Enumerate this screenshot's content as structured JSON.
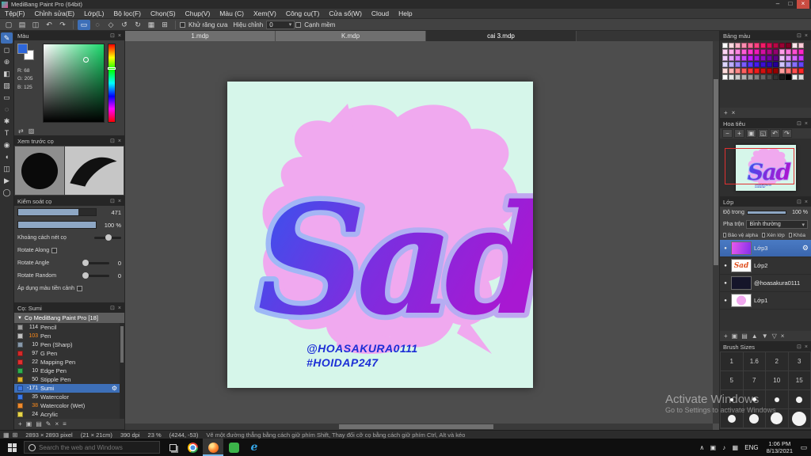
{
  "window": {
    "title": "MediBang Paint Pro (64bit)",
    "controls": {
      "minimize": "–",
      "maximize": "□",
      "close": "×"
    }
  },
  "glyphs": {
    "eye": "●",
    "gear": "⚙",
    "caret_down": "▾",
    "group_caret": "▼"
  },
  "panel_chrome": {
    "pop": "⊡",
    "close": "×"
  },
  "menu": {
    "items": [
      "Tệp(F)",
      "Chỉnh sửa(E)",
      "Lớp(L)",
      "Bộ lọc(F)",
      "Chọn(S)",
      "Chụp(V)",
      "Màu (C)",
      "Xem(V)",
      "Công cụ(T)",
      "Cửa sổ(W)",
      "Cloud",
      "Help"
    ]
  },
  "toolbar": {
    "file_icons": [
      {
        "name": "new-file",
        "glyph": "▢"
      },
      {
        "name": "open-file",
        "glyph": "▤"
      },
      {
        "name": "save-file",
        "glyph": "◫"
      },
      {
        "name": "undo",
        "glyph": "↶"
      },
      {
        "name": "redo",
        "glyph": "↷"
      }
    ],
    "edit_icons": [
      {
        "name": "select-rect",
        "glyph": "▭",
        "active": true
      },
      {
        "name": "lasso-select",
        "glyph": "◌"
      },
      {
        "name": "transform",
        "glyph": "◇"
      },
      {
        "name": "rotate-left",
        "glyph": "↺"
      },
      {
        "name": "rotate-right",
        "glyph": "↻"
      },
      {
        "name": "grid-toggle",
        "glyph": "▦"
      },
      {
        "name": "snap-toggle",
        "glyph": "⊞"
      }
    ],
    "antialias_label": "Khử răng cưa",
    "correction_label": "Hiệu chỉnh",
    "correction_value": "0",
    "soft_edge_label": "Cạnh mềm"
  },
  "tabs": [
    {
      "label": "1.mdp"
    },
    {
      "label": "K.mdp"
    },
    {
      "label": "cai 3.mdp",
      "active": true
    }
  ],
  "tool_strip": [
    {
      "name": "brush-tool",
      "glyph": "✎",
      "active": true
    },
    {
      "name": "eraser-tool",
      "glyph": "◻"
    },
    {
      "name": "move-tool",
      "glyph": "⊕"
    },
    {
      "name": "fill-tool",
      "glyph": "◧"
    },
    {
      "name": "gradient-tool",
      "glyph": "▨"
    },
    {
      "name": "select-tool",
      "glyph": "▭"
    },
    {
      "name": "lasso-tool",
      "glyph": "◌"
    },
    {
      "name": "magic-wand-tool",
      "glyph": "✱"
    },
    {
      "name": "text-tool",
      "glyph": "T"
    },
    {
      "name": "eyedropper-tool",
      "glyph": "◉"
    },
    {
      "name": "hand-tool",
      "glyph": "◖"
    },
    {
      "name": "divide-tool",
      "glyph": "◫"
    },
    {
      "name": "operation-tool",
      "glyph": "▶"
    },
    {
      "name": "zoom-tool",
      "glyph": "◯"
    }
  ],
  "color_panel": {
    "title": "Màu",
    "fg_color": "#2d66d9",
    "bg_color": "#ffffff",
    "r_label": "R: 68",
    "g_label": "G: 205",
    "b_label": "B: 125",
    "footer_icons": [
      {
        "name": "swap-colors",
        "glyph": "⇄"
      },
      {
        "name": "transparent-color",
        "glyph": "▨"
      }
    ]
  },
  "brush_preview": {
    "title": "Xem trước cọ"
  },
  "brush_control": {
    "title": "Kiểm soát cọ",
    "size_value": "471",
    "opacity_value": "100 %",
    "spacing_label": "Khoảng cách nét cọ",
    "rotate_along_label": "Rotate Along",
    "rotate_angle_label": "Rotate Angle",
    "rotate_angle_value": "0",
    "rotate_random_label": "Rotate Random",
    "rotate_random_value": "0",
    "fg_apply_label": "Áp dụng màu tiền cảnh"
  },
  "brush_panel": {
    "title": "Cọ: Sumi",
    "group_label": "Cọ MediBang Paint Pro [18]",
    "brushes": [
      {
        "num": "114",
        "name": "Pencil",
        "chip": "#9c9c9c",
        "num_color": "#e0e0e0"
      },
      {
        "num": "103",
        "name": "Pen",
        "chip": "#c0c0c0",
        "num_color": "#ff8c1a"
      },
      {
        "num": "10",
        "name": "Pen (Sharp)",
        "chip": "#8899aa",
        "num_color": "#e0e0e0"
      },
      {
        "num": "97",
        "name": "G Pen",
        "chip": "#d42a2a",
        "num_color": "#e0e0e0"
      },
      {
        "num": "22",
        "name": "Mapping Pen",
        "chip": "#e03030",
        "num_color": "#e0e0e0"
      },
      {
        "num": "10",
        "name": "Edge Pen",
        "chip": "#2fae4f",
        "num_color": "#e0e0e0"
      },
      {
        "num": "50",
        "name": "Stipple Pen",
        "chip": "#e0b32a",
        "num_color": "#e0e0e0"
      },
      {
        "num": "-171",
        "name": "Sumi",
        "chip": "#3a78e8",
        "num_color": "#ffffff",
        "selected": true
      },
      {
        "num": "35",
        "name": "Watercolor",
        "chip": "#3a78e8",
        "num_color": "#e0e0e0"
      },
      {
        "num": "38",
        "name": "Watercolor (Wet)",
        "chip": "#ef8b2e",
        "num_color": "#ff8c1a"
      },
      {
        "num": "24",
        "name": "Acrylic",
        "chip": "#e8d54a",
        "num_color": "#e0e0e0"
      }
    ],
    "footer_icons": [
      {
        "name": "add-brush",
        "glyph": "+"
      },
      {
        "name": "duplicate-brush",
        "glyph": "▣"
      },
      {
        "name": "brush-folder",
        "glyph": "▤"
      },
      {
        "name": "edit-brush",
        "glyph": "✎"
      },
      {
        "name": "delete-brush",
        "glyph": "×"
      },
      {
        "name": "brush-menu",
        "glyph": "≡"
      }
    ]
  },
  "palette": {
    "title": "Bảng màu",
    "swatches": [
      [
        "#ffffff",
        "#ffd9e0",
        "#ffb3c8",
        "#ff8cb0",
        "#ff6698",
        "#ff4080",
        "#f21b68",
        "#d40e56",
        "#b60845",
        "#980334",
        "#7a0023",
        "#ffe6ec",
        "#ffccd9"
      ],
      [
        "#ffd6f5",
        "#ffadeb",
        "#ff85e0",
        "#ff5cd6",
        "#ff33cc",
        "#f01bb8",
        "#d20fa0",
        "#b40788",
        "#960070",
        "#ff9ee8",
        "#ff76dd",
        "#ff4ed1",
        "#ff26c6"
      ],
      [
        "#f3d1ff",
        "#e7a3ff",
        "#da75ff",
        "#ce47ff",
        "#c219ff",
        "#a912e0",
        "#900bc1",
        "#7704a2",
        "#5e0083",
        "#efc2ff",
        "#e394ff",
        "#d866ff",
        "#cc38ff"
      ],
      [
        "#ddd6ff",
        "#bcadff",
        "#9a85ff",
        "#795cff",
        "#5733ff",
        "#451bf0",
        "#3a0fd2",
        "#2f07b4",
        "#240096",
        "#cfc4ff",
        "#ab9aff",
        "#8770ff",
        "#6346ff"
      ],
      [
        "#ffdddd",
        "#ffb3b3",
        "#ff8989",
        "#ff5f5f",
        "#ff3636",
        "#f01b1b",
        "#d20f0f",
        "#b40707",
        "#960000",
        "#ff9e9e",
        "#ff7676",
        "#ff4e4e",
        "#ff2626"
      ],
      [
        "#ffffff",
        "#e6e6e6",
        "#cccccc",
        "#b3b3b3",
        "#999999",
        "#808080",
        "#666666",
        "#4d4d4d",
        "#333333",
        "#1a1a1a",
        "#000000",
        "#f2f2f2",
        "#d9d9d9"
      ]
    ],
    "footer_icons": [
      {
        "name": "add-color",
        "glyph": "+"
      },
      {
        "name": "delete-color",
        "glyph": "×"
      }
    ]
  },
  "navigator": {
    "title": "Hoa tiêu",
    "buttons": [
      {
        "name": "zoom-out",
        "glyph": "−"
      },
      {
        "name": "zoom-in",
        "glyph": "+"
      },
      {
        "name": "zoom-fit",
        "glyph": "▣"
      },
      {
        "name": "zoom-actual",
        "glyph": "◱"
      },
      {
        "name": "rotate-view-left",
        "glyph": "↶"
      },
      {
        "name": "rotate-view-right",
        "glyph": "↷"
      }
    ]
  },
  "layers_panel": {
    "title": "Lớp",
    "opacity_label": "Độ trong",
    "opacity_value": "100 %",
    "blend_label": "Pha trộn",
    "blend_value": "Bình thường",
    "protect_alpha_label": "Bảo vệ alpha",
    "clip_label": "Xén lớp",
    "lock_label": "Khóa",
    "items": [
      {
        "name": "Lớp3",
        "thumb": "gradient",
        "selected": true
      },
      {
        "name": "Lớp2",
        "thumb": "sad"
      },
      {
        "name": "@hoasakura0111",
        "thumb": "dark"
      },
      {
        "name": "Lớp1",
        "thumb": "pink"
      }
    ],
    "footer_icons": [
      {
        "name": "add-layer",
        "glyph": "+"
      },
      {
        "name": "duplicate-layer",
        "glyph": "▣"
      },
      {
        "name": "layer-folder",
        "glyph": "▤"
      },
      {
        "name": "move-layer-up",
        "glyph": "▲"
      },
      {
        "name": "move-layer-down",
        "glyph": "▼"
      },
      {
        "name": "merge-layer",
        "glyph": "▽"
      },
      {
        "name": "delete-layer",
        "glyph": "×"
      }
    ]
  },
  "brush_sizes": {
    "title": "Brush Sizes",
    "cells": [
      {
        "t": "n",
        "v": "1"
      },
      {
        "t": "n",
        "v": "1.6"
      },
      {
        "t": "n",
        "v": "2"
      },
      {
        "t": "n",
        "v": "3"
      },
      {
        "t": "n",
        "v": "5"
      },
      {
        "t": "n",
        "v": "7"
      },
      {
        "t": "n",
        "v": "10"
      },
      {
        "t": "n",
        "v": "15"
      },
      {
        "t": "d",
        "v": 4
      },
      {
        "t": "d",
        "v": 5
      },
      {
        "t": "d",
        "v": 6
      },
      {
        "t": "d",
        "v": 8
      },
      {
        "t": "d",
        "v": 10
      },
      {
        "t": "d",
        "v": 12
      },
      {
        "t": "d",
        "v": 15
      },
      {
        "t": "d",
        "v": 18
      }
    ]
  },
  "canvas": {
    "title": "Sad",
    "artist": "@HOASAKURA0111",
    "hashtag": "#HOIDAP247",
    "bg": "#d6f6ea",
    "blob": "#f0a9ef",
    "grad_start": "#2f58ef",
    "grad_mid": "#7a2fe0",
    "grad_end": "#a818d2",
    "outline_start": "#9db9f6",
    "outline_end": "#c3a6f0"
  },
  "status": {
    "icons": [
      {
        "name": "grid-indicator-icon",
        "glyph": "▦"
      },
      {
        "name": "snap-indicator-icon",
        "glyph": "⊞"
      }
    ],
    "dimensions": "2893 × 2893 pixel",
    "size_cm": "(21 × 21cm)",
    "dpi": "390 dpi",
    "zoom": "23 %",
    "coords": "(4244, -53)",
    "hint": "Vẽ một đường thẳng bằng cách giữ phím Shift, Thay đổi cỡ cọ bằng cách giữ phím Ctrl, Alt và kéo"
  },
  "taskbar": {
    "search_placeholder": "Search the web and Windows",
    "apps": [
      {
        "name": "chrome",
        "color": "#4285f4"
      },
      {
        "name": "firefox",
        "color": "#ff7139",
        "active": true
      },
      {
        "name": "medibang",
        "color": "#3cb44a"
      },
      {
        "name": "edge",
        "color": "#35a5e5",
        "glyph": "e"
      }
    ],
    "tray_icons": [
      {
        "name": "tray-expand-icon",
        "glyph": "∧"
      },
      {
        "name": "tray-app-icon",
        "glyph": "▣"
      },
      {
        "name": "volume-icon",
        "glyph": "♪"
      },
      {
        "name": "network-icon",
        "glyph": "▦"
      }
    ],
    "lang": "ENG",
    "time": "1:06 PM",
    "date": "8/13/2021",
    "action_center_glyph": "▭"
  },
  "watermark": {
    "line1": "Activate Windows",
    "line2": "Go to Settings to activate Windows"
  }
}
